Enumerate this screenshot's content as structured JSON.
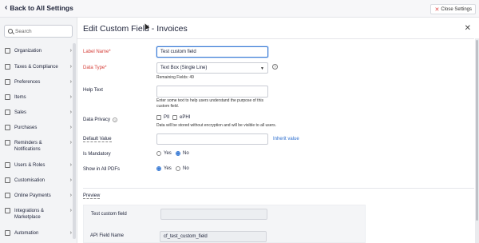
{
  "topbar": {
    "back_label": "Back to All Settings",
    "close_label": "Close Settings"
  },
  "sidebar": {
    "search_placeholder": "Search",
    "items": [
      {
        "label": "Organization",
        "icon": "building-icon"
      },
      {
        "label": "Taxes & Compliance",
        "icon": "tax-icon"
      },
      {
        "label": "Preferences",
        "icon": "preferences-icon"
      },
      {
        "label": "Items",
        "icon": "items-icon"
      },
      {
        "label": "Sales",
        "icon": "cart-icon"
      },
      {
        "label": "Purchases",
        "icon": "bag-icon"
      },
      {
        "label": "Reminders & Notifications",
        "icon": "bell-icon"
      },
      {
        "label": "Users & Roles",
        "icon": "users-icon"
      },
      {
        "label": "Customisation",
        "icon": "palette-icon"
      },
      {
        "label": "Online Payments",
        "icon": "card-icon"
      },
      {
        "label": "Integrations & Marketplace",
        "icon": "puzzle-icon"
      },
      {
        "label": "Automation",
        "icon": "automation-icon"
      }
    ]
  },
  "panel": {
    "title": "Edit Custom Field - Invoices",
    "label_name": {
      "label": "Label Name*",
      "value": "Test custom field"
    },
    "data_type": {
      "label": "Data Type*",
      "value": "Text Box (Single Line)",
      "remaining": "Remaining Fields: 49"
    },
    "help_text": {
      "label": "Help Text",
      "note": "Enter some text to help users understand the purpose of this custom field."
    },
    "data_privacy": {
      "label": "Data Privacy",
      "pii": "PII",
      "ephi": "ePHI",
      "note": "Data will be stored without encryption and will be visible to all users."
    },
    "default_value": {
      "label": "Default Value",
      "link": "Inherit value"
    },
    "is_mandatory": {
      "label": "Is Mandatory",
      "yes": "Yes",
      "no": "No",
      "selected": "No"
    },
    "show_in_pdfs": {
      "label": "Show in All PDFs",
      "yes": "Yes",
      "no": "No",
      "selected": "Yes"
    },
    "preview": {
      "label": "Preview",
      "field_label": "Test custom field",
      "api_label": "API Field Name",
      "api_value": "cf_test_custom_field"
    }
  }
}
